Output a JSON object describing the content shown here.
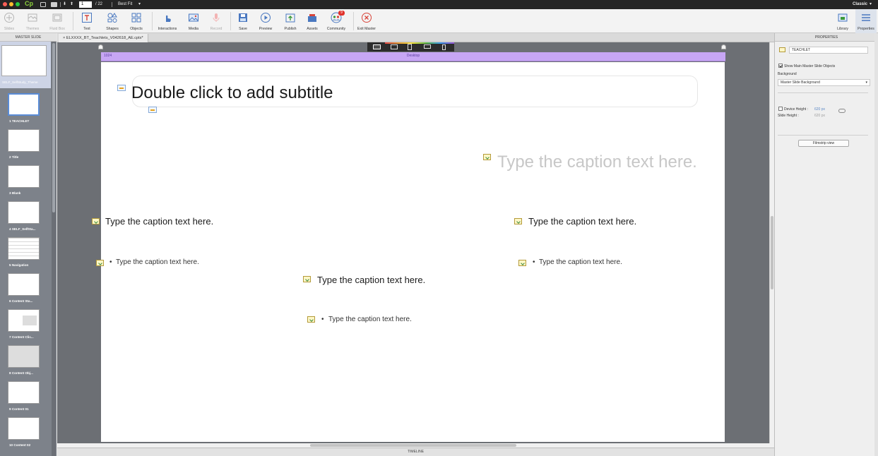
{
  "titlebar": {
    "page_current": "1",
    "page_total": "/ 22",
    "zoom": "Best Fit",
    "mode": "Classic"
  },
  "toolbar": {
    "slides": "Slides",
    "themes": "Themes",
    "fluid_box": "Fluid Box",
    "text": "Text",
    "shapes": "Shapes",
    "objects": "Objects",
    "interactions": "Interactions",
    "media": "Media",
    "record": "Record",
    "save": "Save",
    "preview": "Preview",
    "publish": "Publish",
    "assets": "Assets",
    "community": "Community",
    "community_badge": "9",
    "exit_master": "Exit Master",
    "library": "Library",
    "properties": "Properties"
  },
  "filmstrip": {
    "header": "MASTER SLIDE",
    "master_label": "SELF_SelfStudy_Theme",
    "slides": [
      {
        "label": "1 TEACHLET",
        "selected": true
      },
      {
        "label": "2 Title"
      },
      {
        "label": "3 Blank"
      },
      {
        "label": "4 SELF_SelfSta..."
      },
      {
        "label": "5 Navigation"
      },
      {
        "label": "6 Content Sta..."
      },
      {
        "label": "7 Content Clic..."
      },
      {
        "label": "8 Content Obj..."
      },
      {
        "label": "9 Content 01"
      },
      {
        "label": "10 Content 02"
      }
    ]
  },
  "document": {
    "tab_label": "ELXXXX_BT_Teachlets_V042618_AE.cptx*"
  },
  "stage": {
    "ruler_left": "1024",
    "ruler_center": "Desktop",
    "subtitle": "Double click to add subtitle",
    "caption_large": "Type the caption text here.",
    "caption_medium": "Type the caption text here.",
    "caption_small": "Type the caption text here.",
    "bullet": "•"
  },
  "timeline": {
    "label": "TIMELINE"
  },
  "properties": {
    "header": "PROPERTIES",
    "name": "TEACHLET",
    "show_main_master": "Show Main Master Slide Objects",
    "background_label": "Background",
    "background_value": "Master Slide Background",
    "device_height": "Device Height :",
    "device_height_value": "620 px",
    "slide_height": "Slide Height :",
    "slide_height_value": "620 px",
    "filmstrip_view": "Filmstrip view"
  },
  "colors": {
    "ruler": "#c7a6f4",
    "stage_bg": "#6c6f74",
    "selection": "#5a8cd6"
  }
}
